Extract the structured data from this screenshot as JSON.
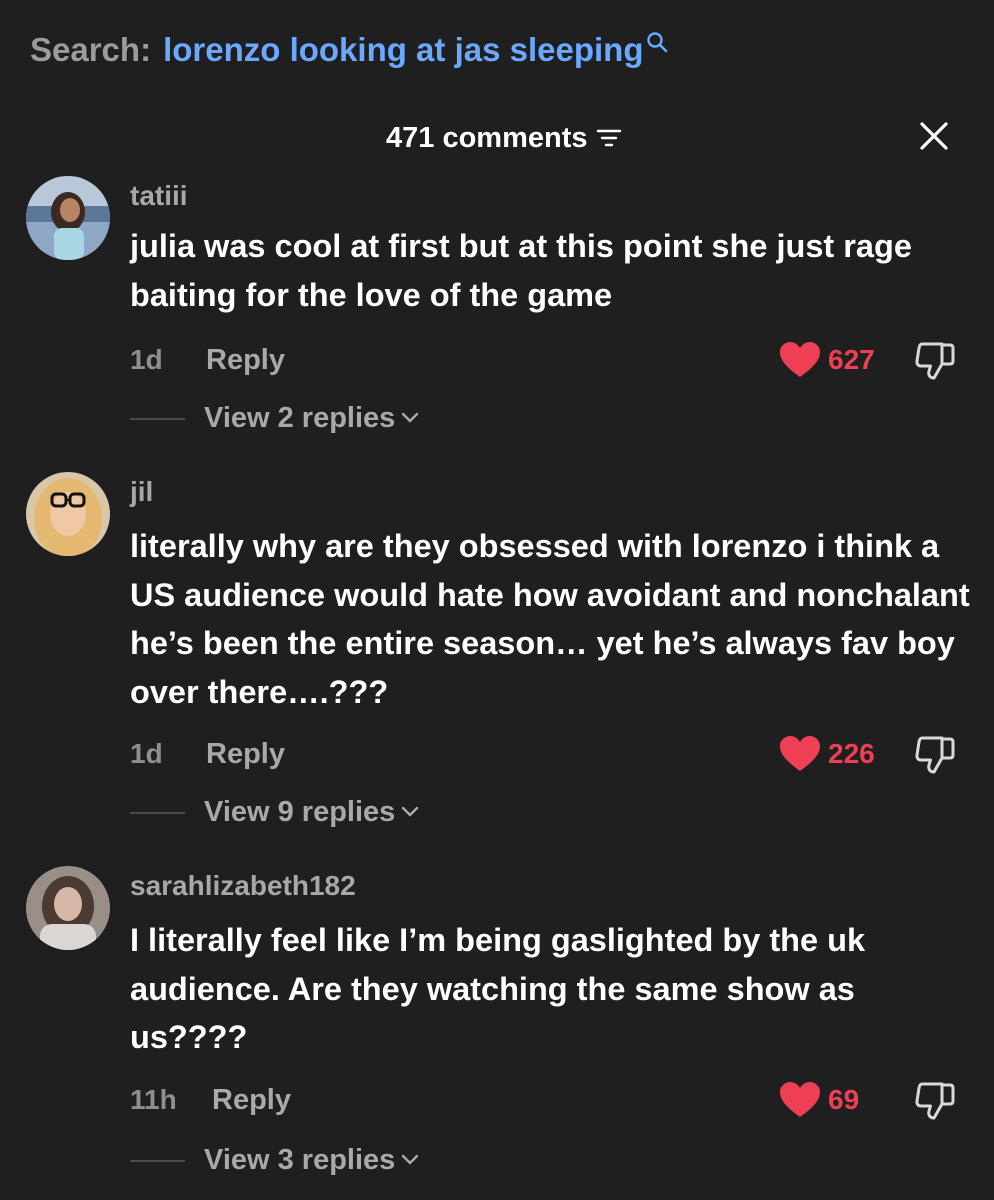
{
  "search": {
    "label": "Search:",
    "query": "lorenzo looking at jas sleeping"
  },
  "header": {
    "count_label": "471 comments"
  },
  "comments": [
    {
      "username": "tatiii",
      "text": "julia was cool at first but at this point she just rage baiting for the love of the game",
      "time": "1d",
      "reply_label": "Reply",
      "likes": "627",
      "view_replies": "View 2 replies"
    },
    {
      "username": "jil",
      "text": "literally why are they obsessed with lorenzo i think a US audience would hate how avoidant and nonchalant he’s been the entire season… yet he’s always fav boy over there….???",
      "time": "1d",
      "reply_label": "Reply",
      "likes": "226",
      "view_replies": "View 9 replies"
    },
    {
      "username": "sarahlizabeth182",
      "text": "I literally feel like I’m being gaslighted by the uk audience. Are they watching the same show as us????",
      "time": "11h",
      "reply_label": "Reply",
      "likes": "69",
      "view_replies": "View 3 replies"
    }
  ],
  "colors": {
    "background": "#1f1f1f",
    "accent_search": "#6aa9ff",
    "like_red": "#ee3f55"
  }
}
